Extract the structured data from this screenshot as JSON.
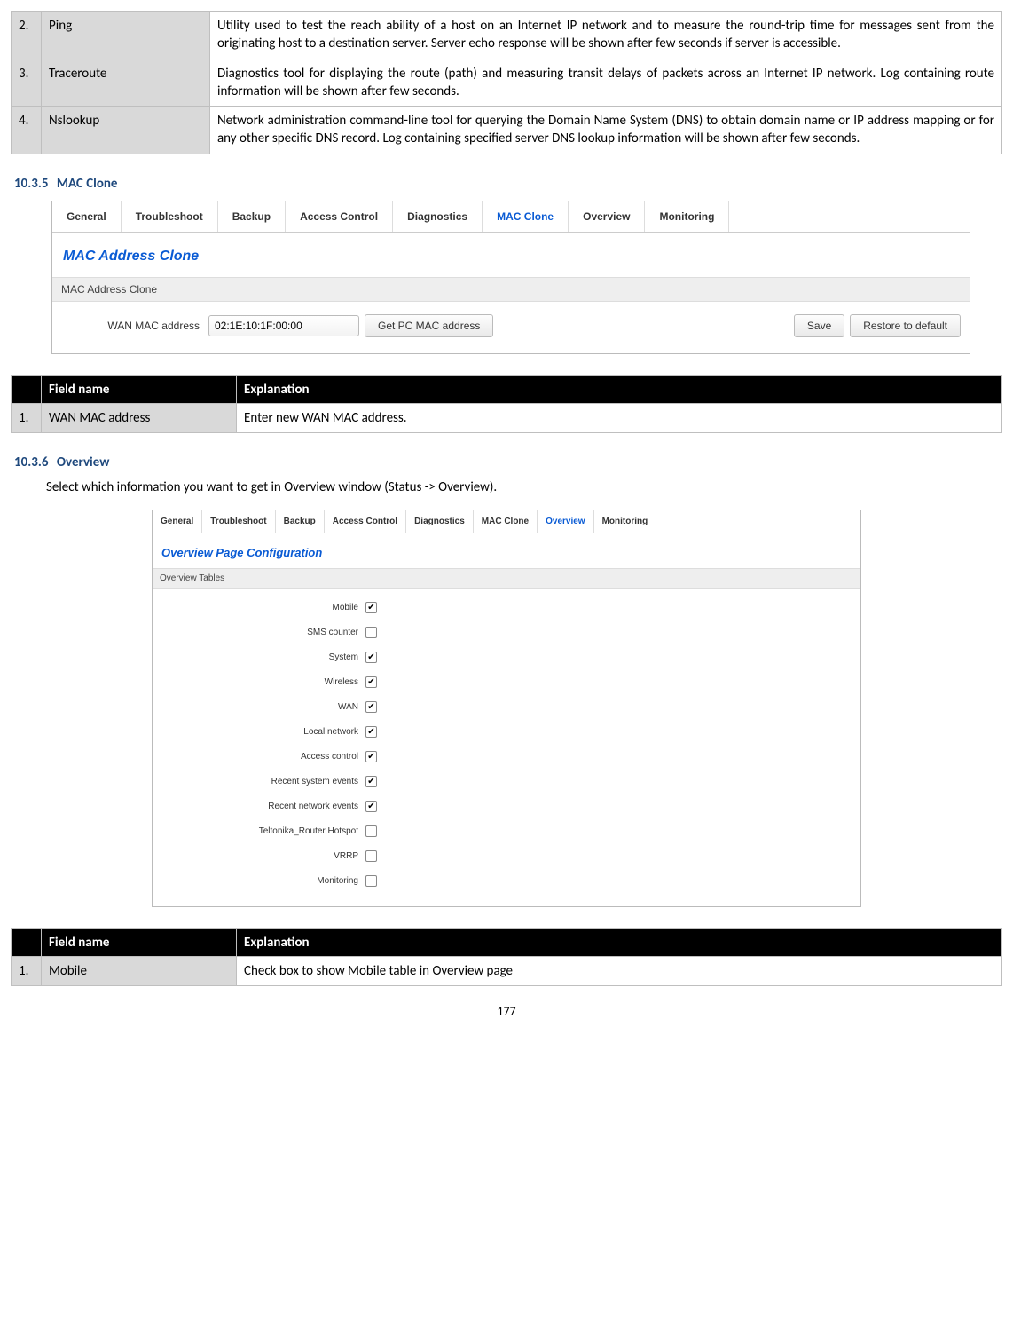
{
  "top_table": {
    "rows": [
      {
        "num": "2.",
        "field": "Ping",
        "desc": "Utility used to test the reach ability of a host on an Internet IP network and to measure the round-trip time for messages sent from the originating host to a destination server. Server echo response will be shown after few seconds if server is accessible."
      },
      {
        "num": "3.",
        "field": "Traceroute",
        "desc": "Diagnostics tool for displaying the route (path) and measuring transit delays of packets across an Internet IP network. Log containing route information will be shown after few seconds."
      },
      {
        "num": "4.",
        "field": "Nslookup",
        "desc": "Network administration command-line tool for querying the Domain Name System (DNS) to obtain domain name or IP address mapping or for any other specific DNS record. Log containing specified server DNS lookup information will be shown after few seconds."
      }
    ]
  },
  "sec1": {
    "num": "10.3.5",
    "title": "MAC Clone"
  },
  "ss1": {
    "tabs": [
      "General",
      "Troubleshoot",
      "Backup",
      "Access Control",
      "Diagnostics",
      "MAC Clone",
      "Overview",
      "Monitoring"
    ],
    "active_tab_index": 5,
    "panel_title": "MAC Address Clone",
    "section_bar": "MAC Address Clone",
    "wan_label": "WAN MAC address",
    "wan_value": "02:1E:10:1F:00:00",
    "btn_getmac": "Get PC MAC address",
    "btn_save": "Save",
    "btn_restore": "Restore to default"
  },
  "table2": {
    "h_field": "Field name",
    "h_expl": "Explanation",
    "rows": [
      {
        "num": "1.",
        "field": "WAN MAC address",
        "desc": "Enter new WAN MAC address."
      }
    ]
  },
  "sec2": {
    "num": "10.3.6",
    "title": "Overview"
  },
  "sec2_text": "Select which information you want to get in Overview window (Status -> Overview).",
  "ss2": {
    "tabs": [
      "General",
      "Troubleshoot",
      "Backup",
      "Access Control",
      "Diagnostics",
      "MAC Clone",
      "Overview",
      "Monitoring"
    ],
    "active_tab_index": 6,
    "panel_title": "Overview Page Configuration",
    "section_bar": "Overview Tables",
    "items": [
      {
        "label": "Mobile",
        "checked": true
      },
      {
        "label": "SMS counter",
        "checked": false
      },
      {
        "label": "System",
        "checked": true
      },
      {
        "label": "Wireless",
        "checked": true
      },
      {
        "label": "WAN",
        "checked": true
      },
      {
        "label": "Local network",
        "checked": true
      },
      {
        "label": "Access control",
        "checked": true
      },
      {
        "label": "Recent system events",
        "checked": true
      },
      {
        "label": "Recent network events",
        "checked": true
      },
      {
        "label": "Teltonika_Router Hotspot",
        "checked": false
      },
      {
        "label": "VRRP",
        "checked": false
      },
      {
        "label": "Monitoring",
        "checked": false
      }
    ]
  },
  "table3": {
    "h_field": "Field name",
    "h_expl": "Explanation",
    "rows": [
      {
        "num": "1.",
        "field": "Mobile",
        "desc": "Check box to show Mobile table in Overview page"
      }
    ]
  },
  "page_number": "177"
}
